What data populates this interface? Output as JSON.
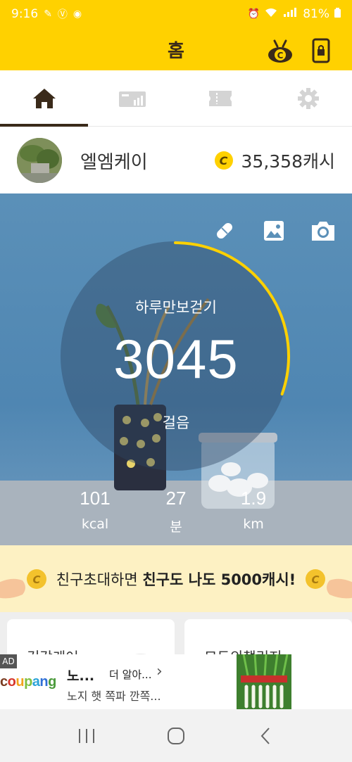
{
  "status_bar": {
    "time": "9:16",
    "battery": "81%",
    "icons": [
      "notification-icon",
      "vk-icon",
      "chat-icon",
      "alarm-icon",
      "wifi-icon",
      "hd-signal-icon",
      "battery-icon"
    ]
  },
  "header": {
    "title": "홈",
    "icons": [
      "mascot-coin-icon",
      "lock-phone-icon"
    ]
  },
  "tabs": [
    {
      "name": "home-tab",
      "icon": "home-icon",
      "active": true
    },
    {
      "name": "stats-tab",
      "icon": "stats-icon",
      "active": false
    },
    {
      "name": "coupon-tab",
      "icon": "ticket-icon",
      "active": false
    },
    {
      "name": "settings-tab",
      "icon": "gear-icon",
      "active": false
    }
  ],
  "profile": {
    "name": "엘엠케이",
    "cash": "35,358캐시",
    "coin_letter": "C"
  },
  "hero": {
    "label": "하루만보걷기",
    "steps": "3045",
    "unit": "걸음",
    "progress_fraction": 0.3045,
    "tools": [
      "pill-icon",
      "image-icon",
      "camera-icon"
    ],
    "stats": [
      {
        "value": "101",
        "label": "kcal"
      },
      {
        "value": "27",
        "label": "분"
      },
      {
        "value": "1.9",
        "label": "km"
      }
    ]
  },
  "banner": {
    "text_prefix": "친구초대하면 ",
    "text_bold": "친구도 나도 5000캐시!"
  },
  "cards": {
    "left_title": "건강케어",
    "right_title": "모두의챌린지"
  },
  "ad": {
    "badge": "AD",
    "logo": "coupang",
    "headline": "노...",
    "more": "더 알아...",
    "chevron": "›",
    "subtitle": "노지 햇 쪽파 깐쪽..."
  },
  "colors": {
    "brand_yellow": "#ffd100",
    "progress_arc": "#ffd100",
    "dark_brown": "#3a2a1a"
  }
}
